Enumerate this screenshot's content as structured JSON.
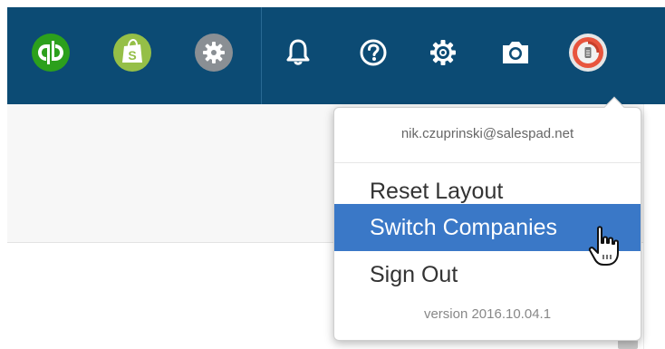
{
  "toolbar": {
    "icons": [
      {
        "name": "quickbooks-icon",
        "color": "#2ca01c"
      },
      {
        "name": "shopify-icon",
        "color": "#95bf47"
      },
      {
        "name": "integration-settings-icon",
        "color": "#8a8f94"
      },
      {
        "name": "bell-icon",
        "color": "#ffffff"
      },
      {
        "name": "help-icon",
        "color": "#ffffff"
      },
      {
        "name": "gear-icon",
        "color": "#ffffff"
      },
      {
        "name": "camera-icon",
        "color": "#ffffff"
      },
      {
        "name": "user-avatar-icon",
        "color": "#e8553e"
      }
    ],
    "background": "#0c4b74"
  },
  "user_menu": {
    "email": "nik.czuprinski@salespad.net",
    "items": [
      {
        "label": "Reset Layout",
        "highlighted": false
      },
      {
        "label": "Switch Companies",
        "highlighted": true
      },
      {
        "label": "Sign Out",
        "highlighted": false
      }
    ],
    "version": "version 2016.10.04.1",
    "highlight_color": "#3a78c7"
  }
}
